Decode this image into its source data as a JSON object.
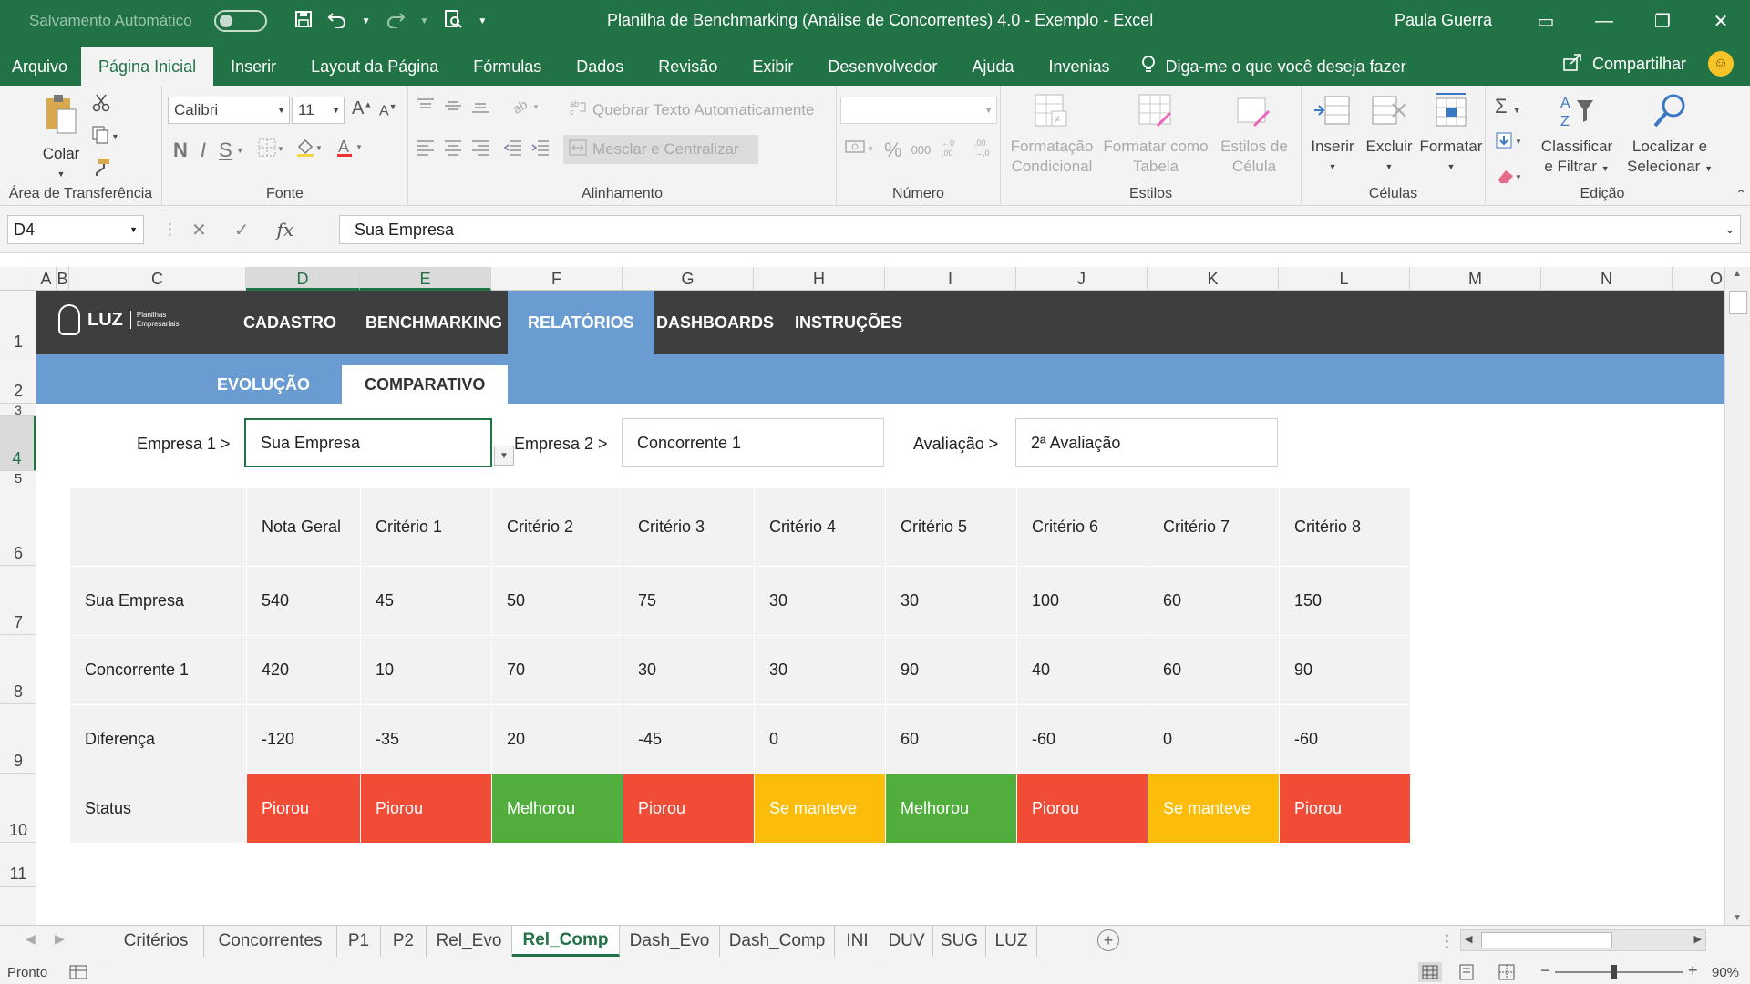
{
  "titlebar": {
    "autosave_label": "Salvamento Automático",
    "title": "Planilha de Benchmarking (Análise de Concorrentes) 4.0 - Exemplo  -  Excel",
    "user": "Paula Guerra"
  },
  "menu": {
    "tabs": [
      "Arquivo",
      "Página Inicial",
      "Inserir",
      "Layout da Página",
      "Fórmulas",
      "Dados",
      "Revisão",
      "Exibir",
      "Desenvolvedor",
      "Ajuda",
      "Invenias"
    ],
    "active_tab": "Página Inicial",
    "tellme": "Diga-me o que você deseja fazer",
    "share": "Compartilhar"
  },
  "ribbon": {
    "clipboard": {
      "paste": "Colar",
      "label": "Área de Transferência"
    },
    "font": {
      "name": "Calibri",
      "size": "11",
      "label": "Fonte"
    },
    "alignment": {
      "wrap": "Quebrar Texto Automaticamente",
      "merge": "Mesclar e Centralizar",
      "label": "Alinhamento"
    },
    "number": {
      "label": "Número",
      "percent": "%",
      "thousands": "000"
    },
    "styles": {
      "cond_1": "Formatação",
      "cond_2": "Condicional",
      "table_1": "Formatar como",
      "table_2": "Tabela",
      "cell_1": "Estilos de",
      "cell_2": "Célula",
      "label": "Estilos"
    },
    "cells": {
      "insert": "Inserir",
      "delete": "Excluir",
      "format": "Formatar",
      "label": "Células"
    },
    "editing": {
      "sort_1": "Classificar",
      "sort_2": "e Filtrar",
      "find_1": "Localizar e",
      "find_2": "Selecionar",
      "label": "Edição"
    }
  },
  "formula_bar": {
    "name_box": "D4",
    "fx": "fx",
    "value": "Sua Empresa"
  },
  "columns": [
    "A",
    "B",
    "C",
    "D",
    "E",
    "F",
    "G",
    "H",
    "I",
    "J",
    "K",
    "L",
    "M",
    "N",
    "O"
  ],
  "rows": [
    "1",
    "2",
    "3",
    "4",
    "5",
    "6",
    "7",
    "8",
    "9",
    "10",
    "11"
  ],
  "sheet_nav": {
    "logo": "LUZ",
    "logo_sub": "Planilhas Empresariais",
    "items": [
      "CADASTRO",
      "BENCHMARKING",
      "RELATÓRIOS",
      "DASHBOARDS",
      "INSTRUÇÕES"
    ],
    "active": "RELATÓRIOS",
    "sub_items": [
      "EVOLUÇÃO",
      "COMPARATIVO"
    ],
    "sub_active": "COMPARATIVO"
  },
  "selectors": {
    "empresa1_label": "Empresa 1 >",
    "empresa1_value": "Sua Empresa",
    "empresa2_label": "Empresa 2 >",
    "empresa2_value": "Concorrente 1",
    "avaliacao_label": "Avaliação >",
    "avaliacao_value": "2ª Avaliação"
  },
  "table": {
    "headers": [
      "",
      "Nota Geral",
      "Critério 1",
      "Critério 2",
      "Critério 3",
      "Critério 4",
      "Critério 5",
      "Critério 6",
      "Critério 7",
      "Critério 8"
    ],
    "rows": [
      {
        "label": "Sua Empresa",
        "values": [
          "540",
          "45",
          "50",
          "75",
          "30",
          "30",
          "100",
          "60",
          "150"
        ]
      },
      {
        "label": "Concorrente 1",
        "values": [
          "420",
          "10",
          "70",
          "30",
          "30",
          "90",
          "40",
          "60",
          "90"
        ]
      },
      {
        "label": "Diferença",
        "values": [
          "-120",
          "-35",
          "20",
          "-45",
          "0",
          "60",
          "-60",
          "0",
          "-60"
        ]
      }
    ],
    "status_label": "Status",
    "status": [
      "Piorou",
      "Piorou",
      "Melhorou",
      "Piorou",
      "Se manteve",
      "Melhorou",
      "Piorou",
      "Se manteve",
      "Piorou"
    ]
  },
  "status_colors": {
    "Piorou": "#f04c36",
    "Melhorou": "#52ae3c",
    "Se manteve": "#fbbd0a"
  },
  "sheet_tabs": [
    "Critérios",
    "Concorrentes",
    "P1",
    "P2",
    "Rel_Evo",
    "Rel_Comp",
    "Dash_Evo",
    "Dash_Comp",
    "INI",
    "DUV",
    "SUG",
    "LUZ"
  ],
  "active_sheet": "Rel_Comp",
  "statusbar": {
    "ready": "Pronto",
    "zoom": "90%"
  },
  "colors": {
    "excel_green": "#217346",
    "nav_dark": "#3e3e3e",
    "nav_blue": "#6a9bd1"
  }
}
